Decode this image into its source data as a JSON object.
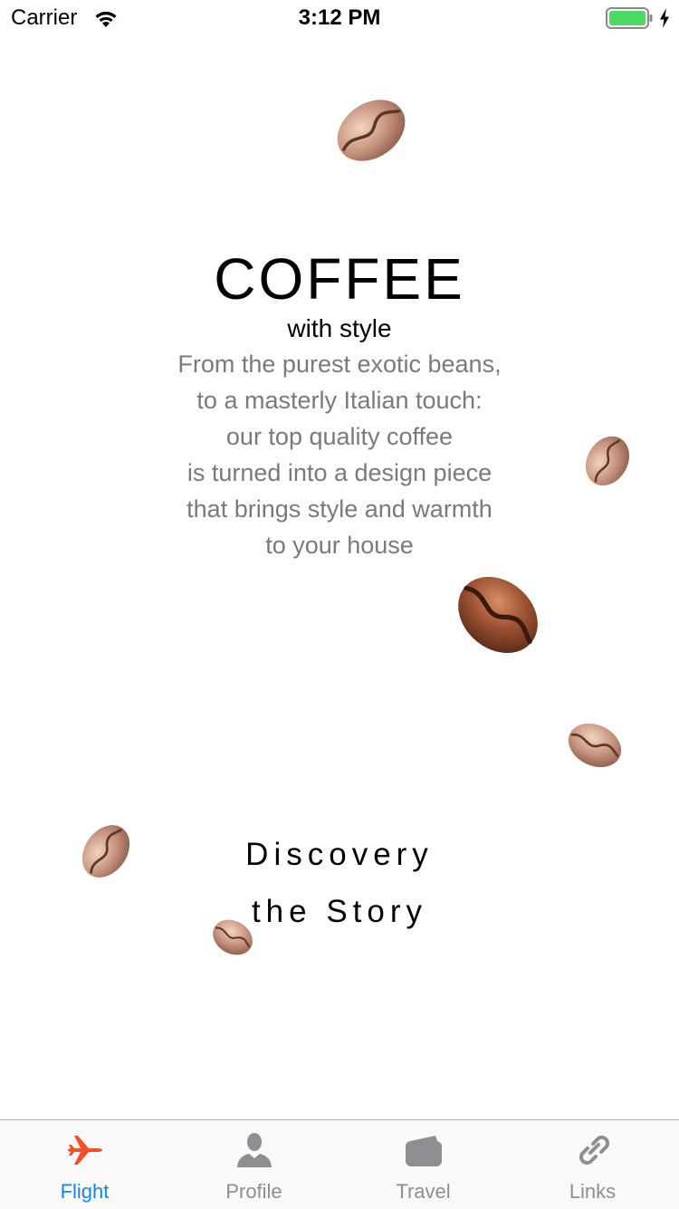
{
  "status_bar": {
    "carrier": "Carrier",
    "time": "3:12 PM",
    "battery_color": "#4cd964"
  },
  "hero": {
    "title": "COFFEE",
    "subtitle": "with style",
    "description_lines": [
      "From the purest exotic beans,",
      "to a masterly Italian touch:",
      "our top quality coffee",
      "is turned into a design piece",
      "that brings style and warmth",
      "to your house"
    ]
  },
  "discovery": {
    "line1": "Discovery",
    "line2": "the Story"
  },
  "tab_bar": {
    "active_color": "#f0502a",
    "active_label_color": "#1a82f0",
    "inactive_color": "#8e8e93",
    "tabs": [
      {
        "label": "Flight",
        "icon": "airplane-icon",
        "active": true
      },
      {
        "label": "Profile",
        "icon": "person-icon",
        "active": false
      },
      {
        "label": "Travel",
        "icon": "wallet-icon",
        "active": false
      },
      {
        "label": "Links",
        "icon": "link-icon",
        "active": false
      }
    ]
  }
}
